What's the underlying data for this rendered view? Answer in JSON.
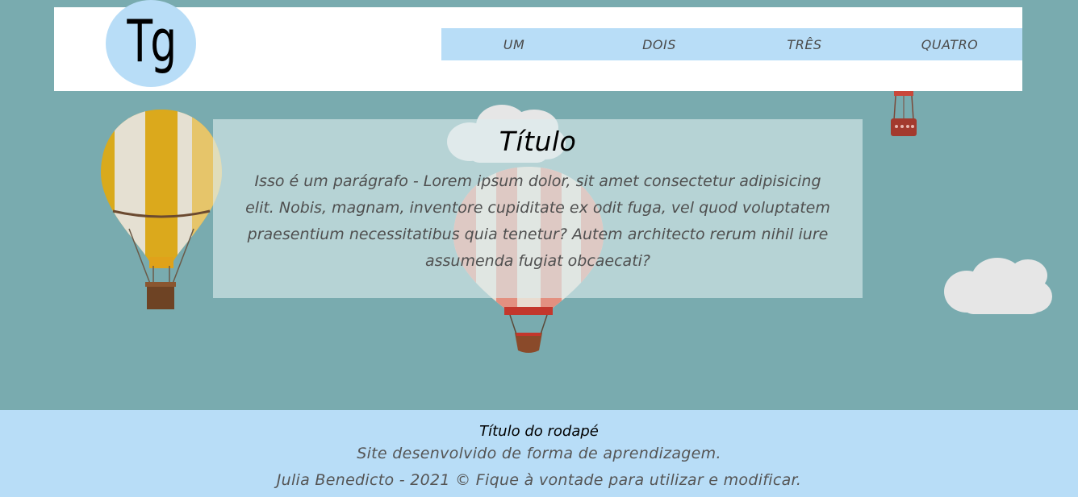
{
  "header": {
    "logo_text": "Tg",
    "nav": [
      {
        "label": "UM"
      },
      {
        "label": "DOIS"
      },
      {
        "label": "TRÊS"
      },
      {
        "label": "QUATRO"
      }
    ]
  },
  "main": {
    "title": "Título",
    "paragraph": "Isso é um parágrafo - Lorem ipsum dolor, sit amet consectetur adipisicing elit. Nobis, magnam, inventore cupiditate ex odit fuga, vel quod voluptatem praesentium necessitatibus quia tenetur? Autem architecto rerum nihil iure assumenda fugiat obcaecati?"
  },
  "footer": {
    "title": "Título do rodapé",
    "line1": "Site desenvolvido de forma de aprendizagem.",
    "line2": "Julia Benedicto - 2021 © Fique à vontade para utilizar e modificar."
  },
  "colors": {
    "background": "#79abaf",
    "accent": "#b8ddf7",
    "header": "#ffffff"
  }
}
